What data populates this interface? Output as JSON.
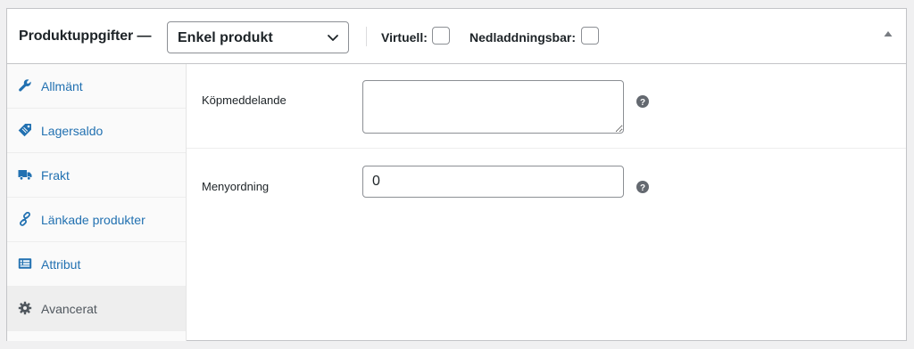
{
  "header": {
    "title": "Produktuppgifter —",
    "product_type": {
      "selected": "Enkel produkt"
    },
    "virtual_label": "Virtuell:",
    "downloadable_label": "Nedladdningsbar:"
  },
  "sidebar": {
    "items": [
      {
        "label": "Allmänt",
        "icon": "wrench-icon",
        "active": false
      },
      {
        "label": "Lagersaldo",
        "icon": "tag-icon",
        "active": false
      },
      {
        "label": "Frakt",
        "icon": "truck-icon",
        "active": false
      },
      {
        "label": "Länkade produkter",
        "icon": "link-icon",
        "active": false
      },
      {
        "label": "Attribut",
        "icon": "list-card-icon",
        "active": false
      },
      {
        "label": "Avancerat",
        "icon": "gear-icon",
        "active": true
      }
    ]
  },
  "main": {
    "purchase_note": {
      "label": "Köpmeddelande",
      "value": ""
    },
    "menu_order": {
      "label": "Menyordning",
      "value": "0"
    }
  },
  "colors": {
    "link": "#2271b1",
    "active_tab_bg": "#eeeeee",
    "border": "#8c8f94"
  }
}
